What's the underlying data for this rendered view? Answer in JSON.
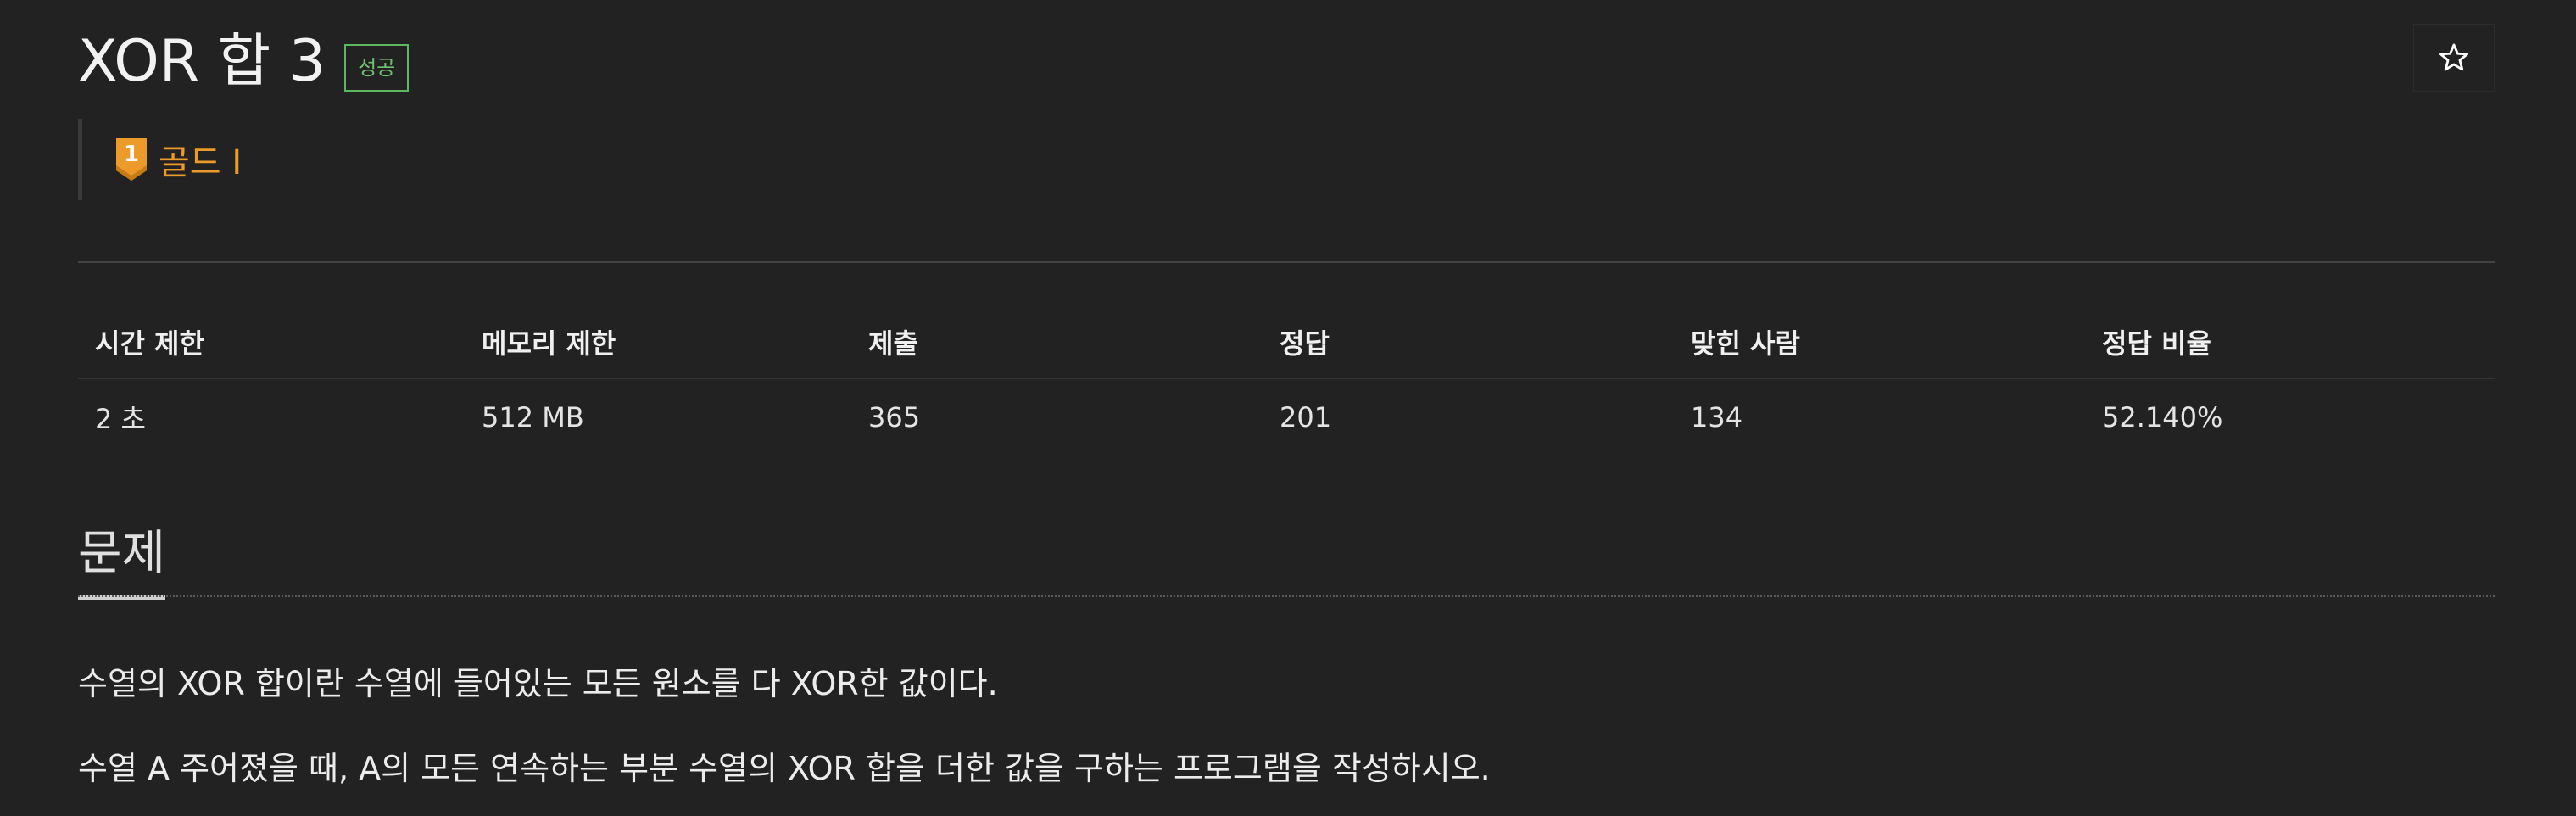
{
  "problem": {
    "title": "XOR 합 3",
    "result_badge": "성공",
    "star_icon": "star-icon"
  },
  "tier": {
    "icon": "gold-tier-badge-icon",
    "icon_number": "1",
    "label": "골드 I",
    "color": "#ec9a29"
  },
  "stats": {
    "headers": [
      "시간 제한",
      "메모리 제한",
      "제출",
      "정답",
      "맞힌 사람",
      "정답 비율"
    ],
    "values": [
      "2 초",
      "512 MB",
      "365",
      "201",
      "134",
      "52.140%"
    ]
  },
  "section": {
    "title": "문제"
  },
  "description": {
    "paragraphs": [
      "수열의 XOR 합이란 수열에 들어있는 모든 원소를 다 XOR한 값이다.",
      "수열 A 주어졌을 때, A의 모든 연속하는 부분 수열의 XOR 합을 더한 값을 구하는 프로그램을 작성하시오."
    ]
  },
  "colors": {
    "background": "#222222",
    "success": "#5cb85c",
    "gold": "#ec9a29"
  }
}
